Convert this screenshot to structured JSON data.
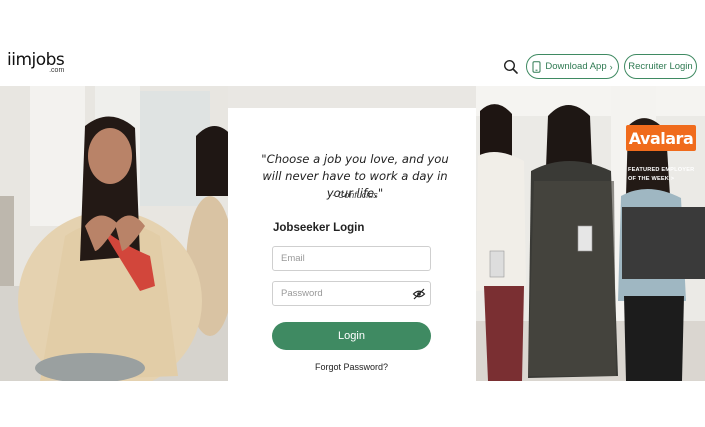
{
  "header": {
    "logo_main": "iimjobs",
    "logo_sub": ".com",
    "download_app": "Download App",
    "recruiter_login": "Recruiter Login"
  },
  "login": {
    "quote": "\"Choose a job you love, and you will never have to work a day in your life.\"",
    "author": "- Confucius",
    "title": "Jobseeker Login",
    "email_placeholder": "Email",
    "password_placeholder": "Password",
    "login_button": "Login",
    "forgot_password": "Forgot Password?"
  },
  "featured": {
    "company": "Avalara",
    "caption": "FEATURED EMPLOYER OF THE WEEK >"
  },
  "icons": [
    "search-icon",
    "phone-icon",
    "eye-slash-icon"
  ],
  "colors": {
    "accent": "#3f8a62",
    "brand_orange": "#f06b1c"
  }
}
